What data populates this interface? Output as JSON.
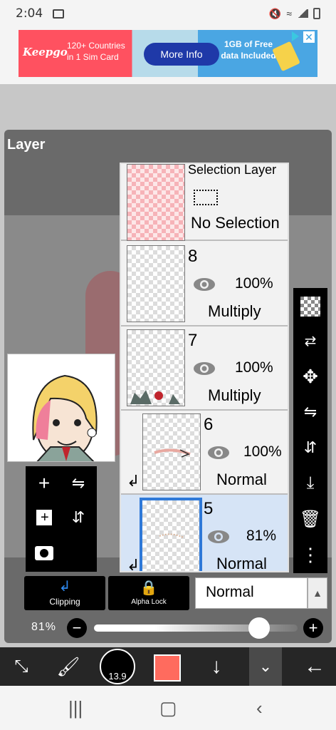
{
  "status_bar": {
    "time": "2:04"
  },
  "ad": {
    "brand": "Keepgo",
    "left_text_line1": "120+ Countries",
    "left_text_line2": "in 1 Sim Card",
    "button": "More Info",
    "right_text_line1": "1GB of Free",
    "right_text_line2": "data Included"
  },
  "panel": {
    "title": "Layer"
  },
  "layers": {
    "selection": {
      "title": "Selection Layer",
      "status": "No Selection"
    },
    "items": [
      {
        "number": "8",
        "opacity": "100%",
        "blend": "Multiply"
      },
      {
        "number": "7",
        "opacity": "100%",
        "blend": "Multiply"
      },
      {
        "number": "6",
        "opacity": "100%",
        "blend": "Normal"
      },
      {
        "number": "5",
        "opacity": "81%",
        "blend": "Normal"
      }
    ]
  },
  "controls": {
    "clipping_label": "Clipping",
    "alpha_lock_label": "Alpha Lock",
    "blend_mode": "Normal",
    "opacity_label": "81%",
    "opacity_value": 0.81
  },
  "toolbar": {
    "brush_size": "13.9",
    "color": "#ff6b5e"
  }
}
